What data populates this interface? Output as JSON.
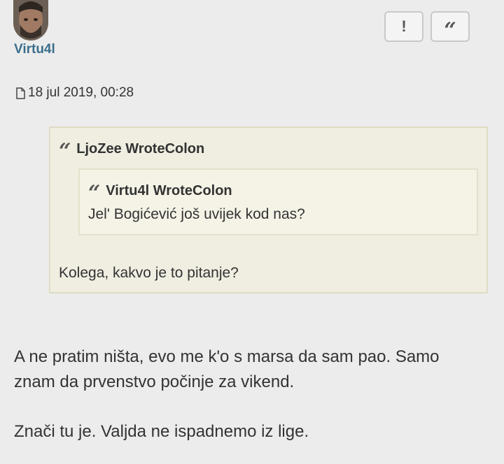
{
  "post": {
    "username": "Virtu4l",
    "date": "18 jul 2019, 00:28",
    "buttons": {
      "report_label": "!",
      "quote_label": "“"
    }
  },
  "quote": {
    "author_line": "LjoZee WroteColon",
    "text": "Kolega, kakvo je to pitanje?",
    "nested": {
      "author_line": "Virtu4l WroteColon",
      "text": "Jel' Bogićević još uvijek kod nas?"
    }
  },
  "message": {
    "line1": "A ne pratim ništa, evo me k'o s marsa da sam pao. Samo",
    "line2": "znam da prvenstvo počinje za vikend.",
    "line3": "Znači tu je. Valjda ne ispadnemo iz lige."
  },
  "icons": {
    "avatar": "user-avatar",
    "date": "post-file-icon",
    "quote": "quote-marks-icon"
  }
}
